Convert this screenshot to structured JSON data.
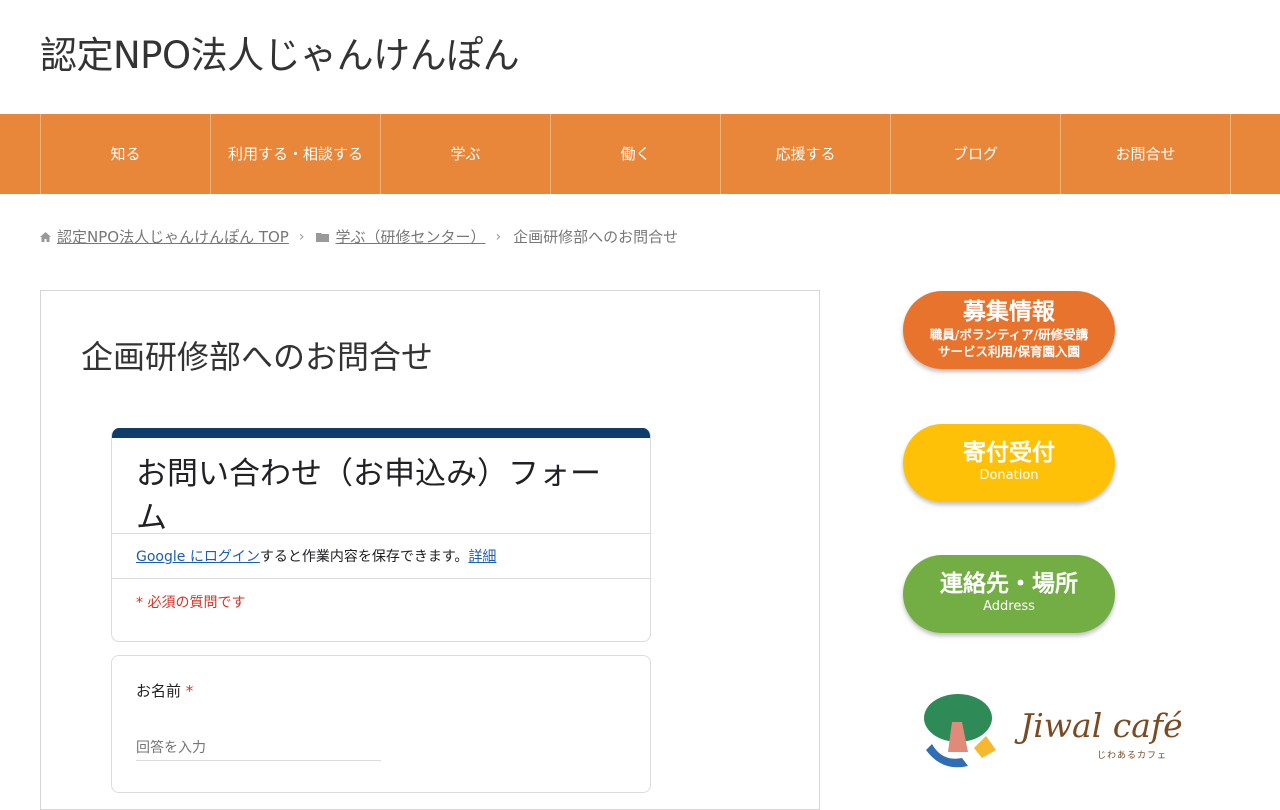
{
  "site": {
    "title": "認定NPO法人じゃんけんぽん"
  },
  "nav": {
    "items": [
      {
        "label": "知る"
      },
      {
        "label": "利用する・相談する"
      },
      {
        "label": "学ぶ"
      },
      {
        "label": "働く"
      },
      {
        "label": "応援する"
      },
      {
        "label": "ブログ"
      },
      {
        "label": "お問合せ"
      }
    ]
  },
  "breadcrumb": {
    "home": "認定NPO法人じゃんけんぽん TOP",
    "category": "学ぶ（研修センター）",
    "current": "企画研修部へのお問合せ"
  },
  "page": {
    "title": "企画研修部へのお問合せ"
  },
  "form": {
    "title": "お問い合わせ（お申込み）フォーム",
    "login_link": "Google にログイン",
    "login_text": "すると作業内容を保存できます。",
    "details_link": "詳細",
    "required_note": "* 必須の質問です",
    "question_name": {
      "label": "お名前",
      "required_mark": "*",
      "placeholder": "回答を入力"
    },
    "accent_color": "#0f3d6b"
  },
  "sidebar": {
    "recruit": {
      "title": "募集情報",
      "line1": "職員/ボランティア/研修受講",
      "line2": "サービス利用/保育園入園"
    },
    "donate": {
      "title": "寄付受付",
      "sub": "Donation"
    },
    "address": {
      "title": "連絡先・場所",
      "sub": "Address"
    },
    "cafe": {
      "name": "Jiwal café",
      "sub": "じわあるカフェ"
    }
  },
  "colors": {
    "nav": "#e8873a",
    "recruit": "#e8732d",
    "donate": "#ffc107",
    "address": "#72ae43"
  }
}
